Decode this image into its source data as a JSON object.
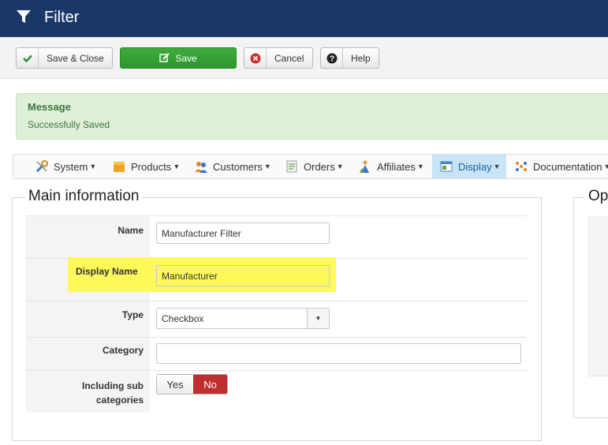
{
  "header": {
    "title": "Filter",
    "icon": "filter-icon"
  },
  "toolbar": {
    "save_close": "Save & Close",
    "save": "Save",
    "cancel": "Cancel",
    "help": "Help"
  },
  "message": {
    "title": "Message",
    "text": "Successfully Saved"
  },
  "nav": {
    "items": [
      {
        "label": "System",
        "icon": "wrench-icon"
      },
      {
        "label": "Products",
        "icon": "box-icon"
      },
      {
        "label": "Customers",
        "icon": "users-icon"
      },
      {
        "label": "Orders",
        "icon": "document-icon"
      },
      {
        "label": "Affiliates",
        "icon": "people-icon"
      },
      {
        "label": "Display",
        "icon": "window-icon",
        "active": true
      },
      {
        "label": "Documentation",
        "icon": "gear-icon"
      }
    ]
  },
  "main": {
    "legend": "Main information",
    "fields": {
      "name_label": "Name",
      "name_value": "Manufacturer Filter",
      "display_name_label": "Display Name",
      "display_name_value": "Manufacturer",
      "type_label": "Type",
      "type_value": "Checkbox",
      "category_label": "Category",
      "category_value": "",
      "including_sub_label_1": "Including sub",
      "including_sub_label_2": "categories",
      "yes": "Yes",
      "no": "No"
    }
  },
  "right": {
    "legend": "Op"
  },
  "colors": {
    "header_bg": "#1a3867",
    "save_green": "#35a235",
    "message_bg": "#dff0d8",
    "highlight_yellow": "#fdf95b",
    "no_red": "#bd2e2e",
    "nav_active": "#c9e4f6"
  }
}
